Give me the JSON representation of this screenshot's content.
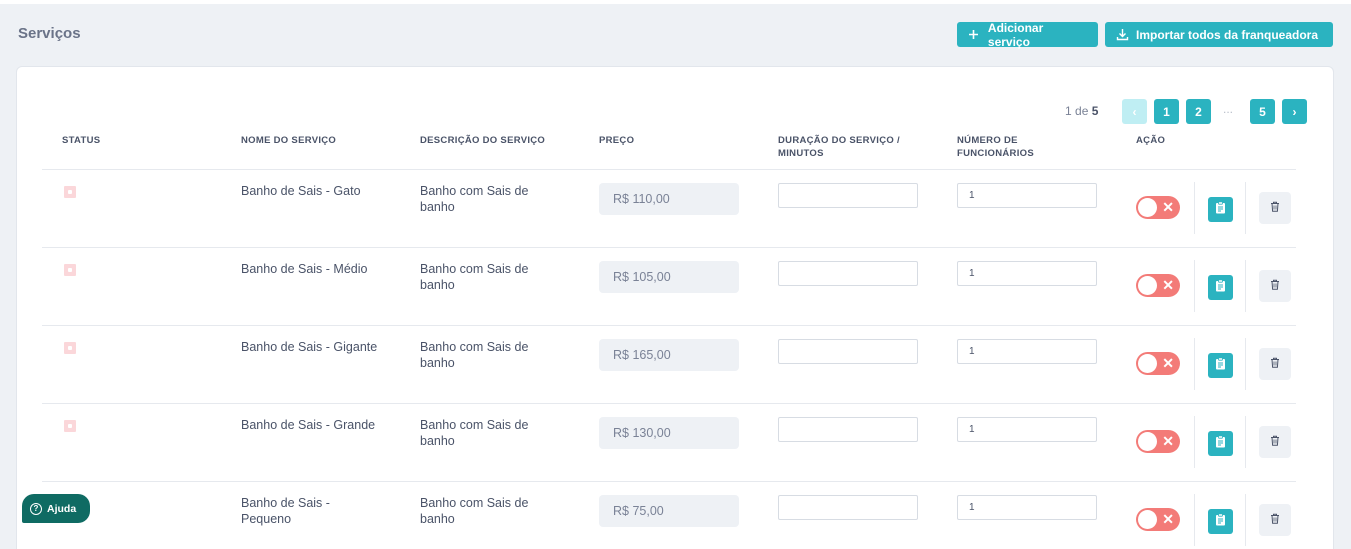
{
  "page": {
    "title": "Serviços",
    "add_button": "Adicionar serviço",
    "import_button": "Importar todos da franqueadora"
  },
  "pagination": {
    "current": "1",
    "of_label": "de",
    "total": "5",
    "prev": "‹",
    "pages": [
      "1",
      "2",
      "5"
    ],
    "dots": "...",
    "next": "›"
  },
  "table": {
    "headers": {
      "status": "STATUS",
      "name": "NOME DO SERVIÇO",
      "description": "DESCRIÇÃO DO SERVIÇO",
      "price": "PREÇO",
      "duration_1": "DURAÇÃO DO SERVIÇO /",
      "duration_2": "MINUTOS",
      "employees_1": "NÚMERO DE",
      "employees_2": "FUNCIONÁRIOS",
      "action": "AÇÃO"
    },
    "rows": [
      {
        "name_1": "Banho de Sais - Gato",
        "name_2": "",
        "desc_1": "Banho com Sais de",
        "desc_2": "banho",
        "price": "R$ 110,00",
        "duration": "",
        "employees": "1"
      },
      {
        "name_1": "Banho de Sais - Médio",
        "name_2": "",
        "desc_1": "Banho com Sais de",
        "desc_2": "banho",
        "price": "R$ 105,00",
        "duration": "",
        "employees": "1"
      },
      {
        "name_1": "Banho de Sais - Gigante",
        "name_2": "",
        "desc_1": "Banho com Sais de",
        "desc_2": "banho",
        "price": "R$ 165,00",
        "duration": "",
        "employees": "1"
      },
      {
        "name_1": "Banho de Sais - Grande",
        "name_2": "",
        "desc_1": "Banho com Sais de",
        "desc_2": "banho",
        "price": "R$ 130,00",
        "duration": "",
        "employees": "1"
      },
      {
        "name_1": "Banho de Sais -",
        "name_2": "Pequeno",
        "desc_1": "Banho com Sais de",
        "desc_2": "banho",
        "price": "R$ 75,00",
        "duration": "",
        "employees": "1"
      }
    ]
  },
  "help": {
    "label": "Ajuda"
  },
  "colors": {
    "accent": "#2bb3c0",
    "toggle_off": "#f37b78",
    "help_bg": "#0f6b63"
  }
}
